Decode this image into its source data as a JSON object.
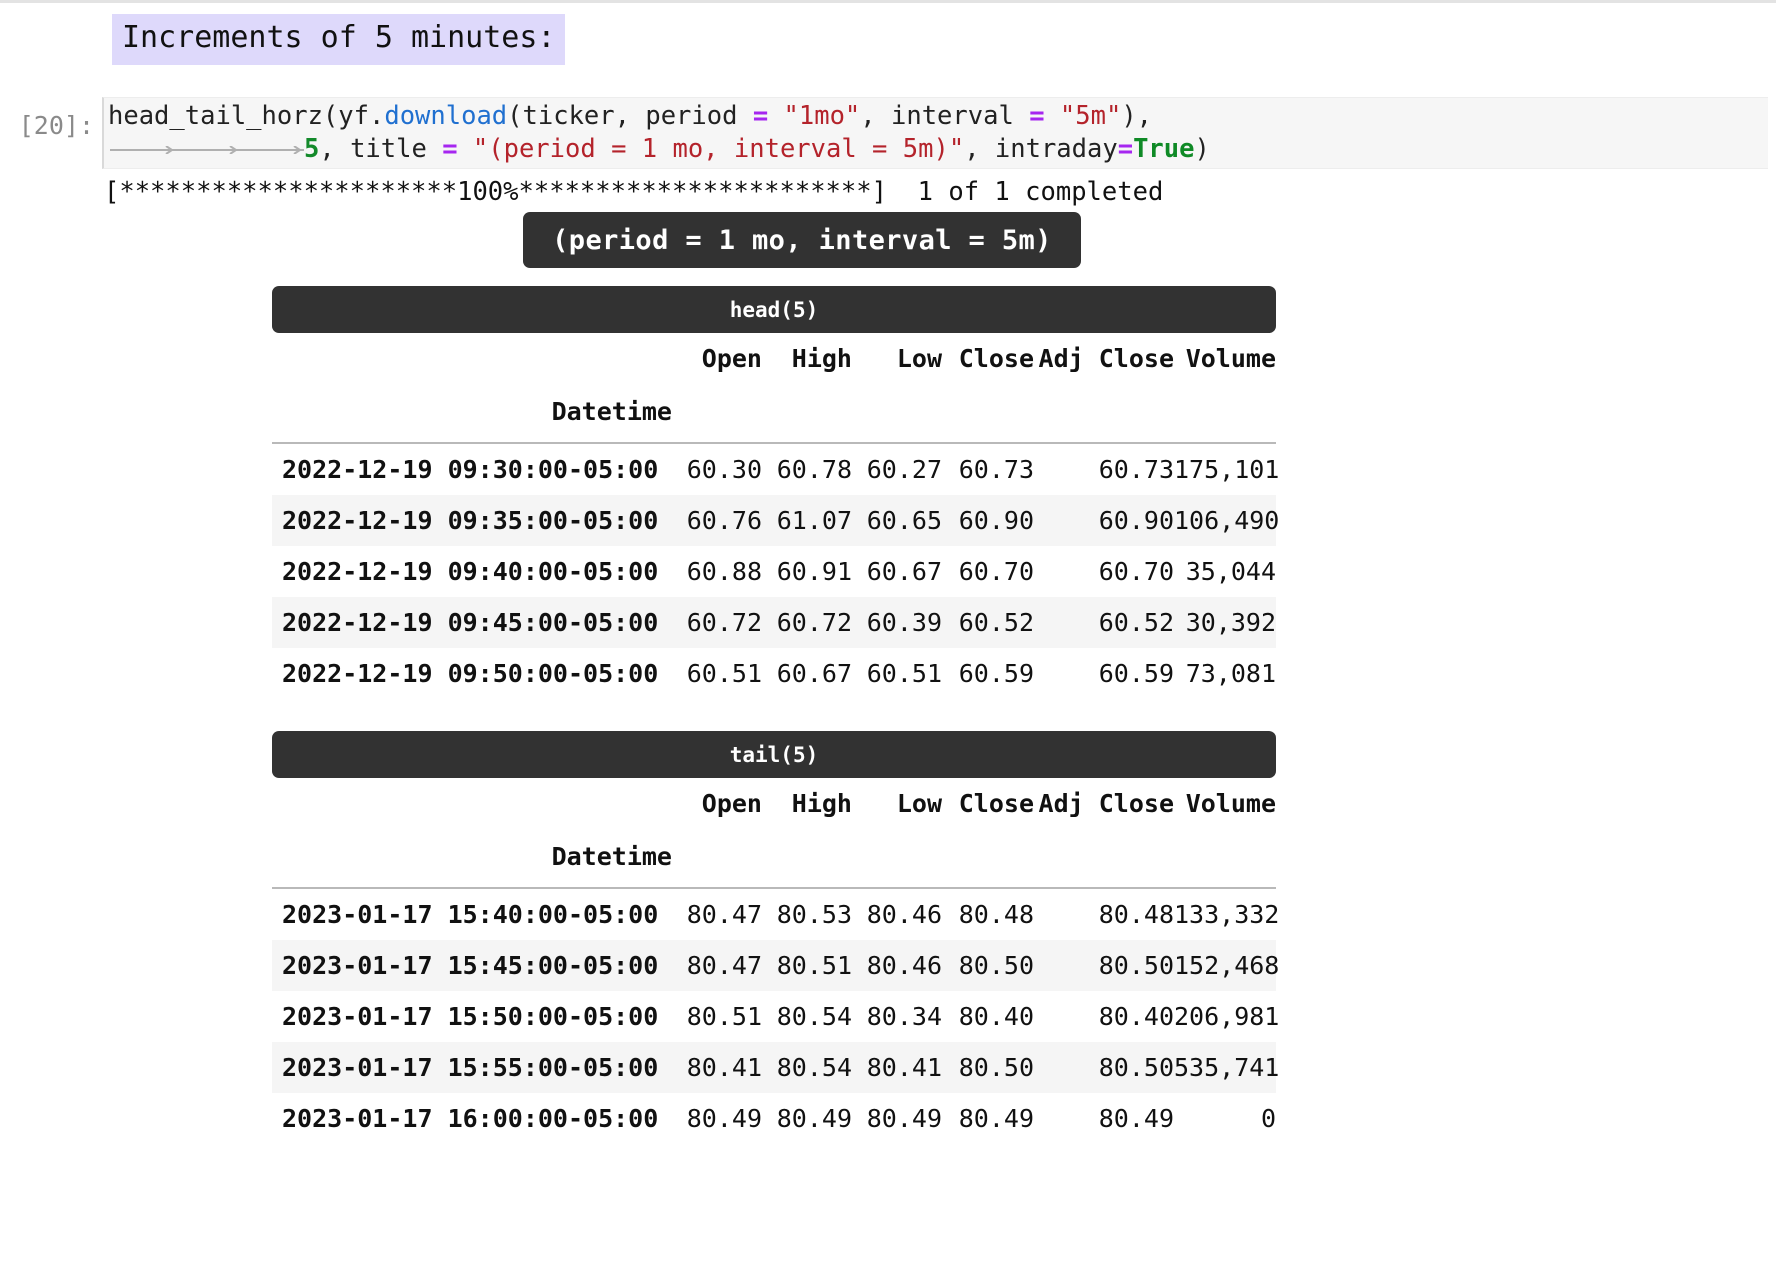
{
  "markdown": {
    "heading": "Increments of 5 minutes:"
  },
  "cell": {
    "prompt": "[20]:",
    "code": {
      "line1": {
        "p1": "head_tail_horz(yf.",
        "fn": "download",
        "p2": "(ticker, period ",
        "op1": "=",
        "s1": " \"1mo\"",
        "p3": ", interval ",
        "op2": "=",
        "s2": " \"5m\"",
        "p4": "),"
      },
      "line2": {
        "num": "5",
        "p1": ", title ",
        "op1": "=",
        "s1": " \"(period = 1 mo, interval = 5m)\"",
        "p2": ", intraday",
        "op2": "=",
        "kw": "True",
        "p3": ")"
      }
    },
    "output_progress": "[**********************100%***********************]  1 of 1 completed"
  },
  "banner": {
    "title": "(period = 1 mo, interval = 5m)"
  },
  "tables": [
    {
      "caption": "head(5)",
      "index_name": "Datetime",
      "columns": [
        "Open",
        "High",
        "Low",
        "Close",
        "Adj Close",
        "Volume"
      ],
      "rows": [
        {
          "index": "2022-12-19 09:30:00-05:00",
          "values": [
            "60.30",
            "60.78",
            "60.27",
            "60.73",
            "60.73",
            "175,101"
          ]
        },
        {
          "index": "2022-12-19 09:35:00-05:00",
          "values": [
            "60.76",
            "61.07",
            "60.65",
            "60.90",
            "60.90",
            "106,490"
          ]
        },
        {
          "index": "2022-12-19 09:40:00-05:00",
          "values": [
            "60.88",
            "60.91",
            "60.67",
            "60.70",
            "60.70",
            "35,044"
          ]
        },
        {
          "index": "2022-12-19 09:45:00-05:00",
          "values": [
            "60.72",
            "60.72",
            "60.39",
            "60.52",
            "60.52",
            "30,392"
          ]
        },
        {
          "index": "2022-12-19 09:50:00-05:00",
          "values": [
            "60.51",
            "60.67",
            "60.51",
            "60.59",
            "60.59",
            "73,081"
          ]
        }
      ]
    },
    {
      "caption": "tail(5)",
      "index_name": "Datetime",
      "columns": [
        "Open",
        "High",
        "Low",
        "Close",
        "Adj Close",
        "Volume"
      ],
      "rows": [
        {
          "index": "2023-01-17 15:40:00-05:00",
          "values": [
            "80.47",
            "80.53",
            "80.46",
            "80.48",
            "80.48",
            "133,332"
          ]
        },
        {
          "index": "2023-01-17 15:45:00-05:00",
          "values": [
            "80.47",
            "80.51",
            "80.46",
            "80.50",
            "80.50",
            "152,468"
          ]
        },
        {
          "index": "2023-01-17 15:50:00-05:00",
          "values": [
            "80.51",
            "80.54",
            "80.34",
            "80.40",
            "80.40",
            "206,981"
          ]
        },
        {
          "index": "2023-01-17 15:55:00-05:00",
          "values": [
            "80.41",
            "80.54",
            "80.41",
            "80.50",
            "80.50",
            "535,741"
          ]
        },
        {
          "index": "2023-01-17 16:00:00-05:00",
          "values": [
            "80.49",
            "80.49",
            "80.49",
            "80.49",
            "80.49",
            "0"
          ]
        }
      ]
    }
  ],
  "colors": {
    "heading_highlight": "#ded9fb",
    "banner_bg": "#323232",
    "code_bg": "#f6f6f6",
    "string_token": "#b4232b",
    "function_token": "#2070d0",
    "operator_token": "#a626f0",
    "keyword_token": "#0f8a26",
    "number_token": "#138a2b",
    "zebra_row": "#f5f5f5"
  }
}
